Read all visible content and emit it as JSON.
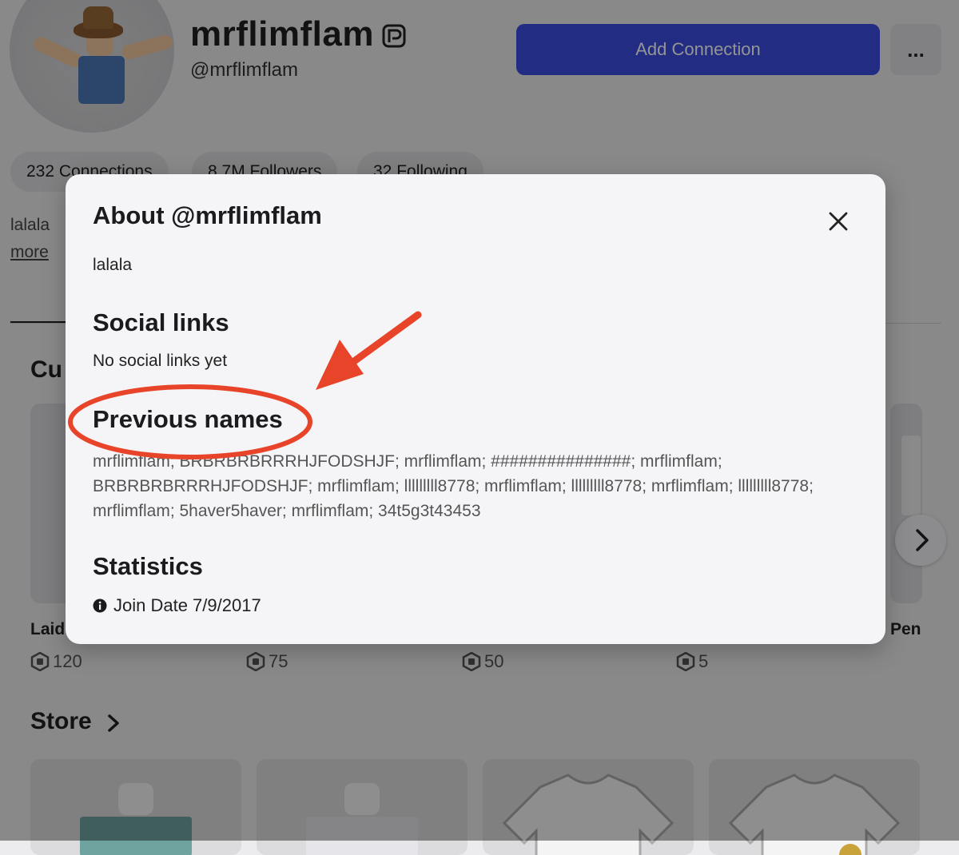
{
  "profile": {
    "display_name": "mrflimflam",
    "handle": "@mrflimflam",
    "add_connection_label": "Add Connection",
    "more_label": "...",
    "connections": "232 Connections",
    "followers": "8.7M Followers",
    "following": "32 Following",
    "bio": "lalala",
    "more_link": "more"
  },
  "creations": {
    "section_title": "Cu",
    "items": [
      {
        "name": "Laid",
        "price": "120"
      },
      {
        "name": "",
        "price": "75"
      },
      {
        "name": "",
        "price": "50"
      },
      {
        "name": "",
        "price": "5"
      },
      {
        "name": "Pen",
        "price": ""
      }
    ]
  },
  "store": {
    "title": "Store"
  },
  "modal": {
    "title": "About @mrflimflam",
    "bio": "lalala",
    "social_heading": "Social links",
    "social_text": "No social links yet",
    "previous_heading": "Previous names",
    "previous_names": "mrflimflam; BRBRBRBRRRHJFODSHJF; mrflimflam; ###############; mrflimflam; BRBRBRBRRRHJFODSHJF; mrflimflam; lllllllll8778; mrflimflam; lllllllll8778; mrflimflam; lllllllll8778; mrflimflam; 5haver5haver; mrflimflam; 34t5g3t43453",
    "stats_heading": "Statistics",
    "join_date": "Join Date 7/9/2017"
  },
  "colors": {
    "accent": "#3a4de0",
    "annotation": "#e8442a"
  },
  "icons": [
    "verified-badge-icon",
    "more-icon",
    "close-icon",
    "info-icon",
    "robux-icon",
    "chevron-right-icon"
  ]
}
